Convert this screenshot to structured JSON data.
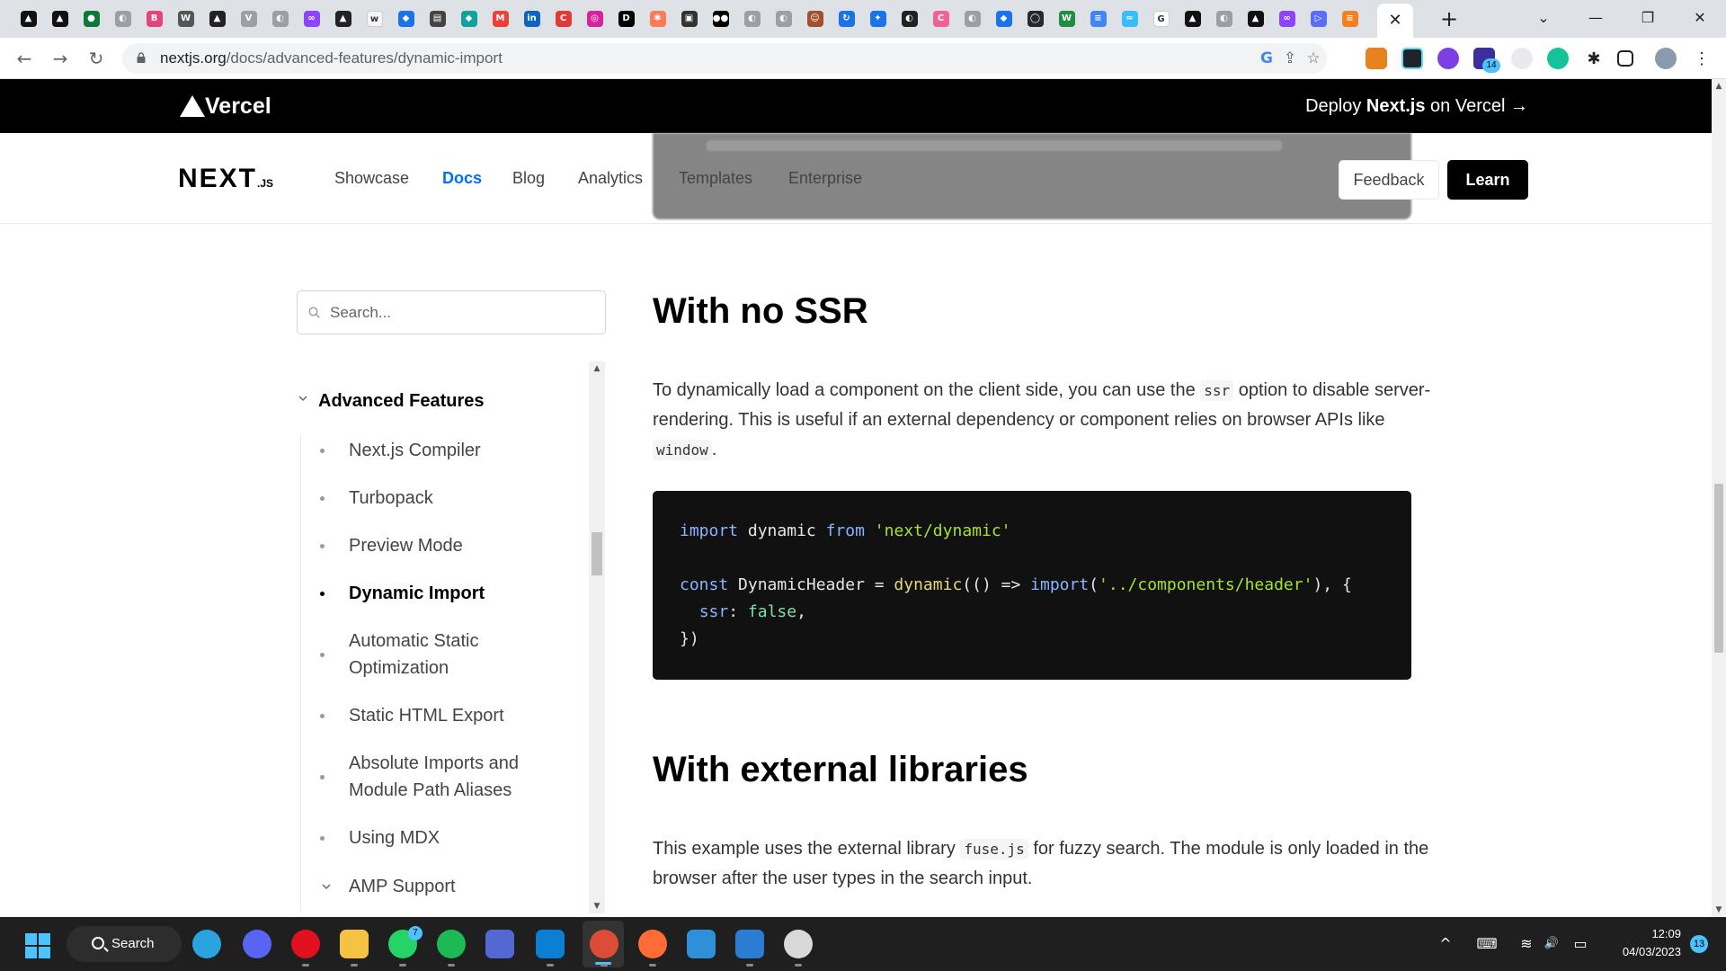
{
  "browser": {
    "tab_favicons": [
      {
        "name": "tab-favicon-1",
        "color": "#111111",
        "glyph": "▲"
      },
      {
        "name": "tab-favicon-2",
        "color": "#111111",
        "glyph": "▲"
      },
      {
        "name": "tab-favicon-3",
        "color": "#0a7a3a",
        "glyph": "●"
      },
      {
        "name": "tab-favicon-4",
        "color": "#9aa0a6",
        "glyph": "◐"
      },
      {
        "name": "tab-favicon-5",
        "color": "#e5447a",
        "glyph": "B"
      },
      {
        "name": "tab-favicon-6",
        "color": "#555555",
        "glyph": "W"
      },
      {
        "name": "tab-favicon-7",
        "color": "#222222",
        "glyph": "▲"
      },
      {
        "name": "tab-favicon-8",
        "color": "#9aa0a6",
        "glyph": "V"
      },
      {
        "name": "tab-favicon-9",
        "color": "#9aa0a6",
        "glyph": "◐"
      },
      {
        "name": "tab-favicon-10",
        "color": "#8e44ff",
        "glyph": "∞"
      },
      {
        "name": "tab-favicon-11",
        "color": "#222222",
        "glyph": "▲"
      },
      {
        "name": "tab-favicon-12",
        "color": "#f5f5f5",
        "glyph": "w"
      },
      {
        "name": "tab-favicon-13",
        "color": "#1a73e8",
        "glyph": "◆"
      },
      {
        "name": "tab-favicon-14",
        "color": "#444444",
        "glyph": "▤"
      },
      {
        "name": "tab-favicon-15",
        "color": "#10a39e",
        "glyph": "◆"
      },
      {
        "name": "tab-favicon-16",
        "color": "#ea4335",
        "glyph": "M"
      },
      {
        "name": "tab-favicon-17",
        "color": "#0a66c2",
        "glyph": "in"
      },
      {
        "name": "tab-favicon-18",
        "color": "#e03a3a",
        "glyph": "C"
      },
      {
        "name": "tab-favicon-19",
        "color": "#d6249f",
        "glyph": "◎"
      },
      {
        "name": "tab-favicon-20",
        "color": "#000000",
        "glyph": "D"
      },
      {
        "name": "tab-favicon-21",
        "color": "#ff7a59",
        "glyph": "✱"
      },
      {
        "name": "tab-favicon-22",
        "color": "#333333",
        "glyph": "▣"
      },
      {
        "name": "tab-favicon-23",
        "color": "#000000",
        "glyph": "●●"
      },
      {
        "name": "tab-favicon-24",
        "color": "#9aa0a6",
        "glyph": "◐"
      },
      {
        "name": "tab-favicon-25",
        "color": "#9aa0a6",
        "glyph": "◐"
      },
      {
        "name": "tab-favicon-26",
        "color": "#a0522d",
        "glyph": "☺"
      },
      {
        "name": "tab-favicon-27",
        "color": "#1a73e8",
        "glyph": "↻"
      },
      {
        "name": "tab-favicon-28",
        "color": "#1a73e8",
        "glyph": "✦"
      },
      {
        "name": "tab-favicon-29",
        "color": "#222222",
        "glyph": "◐"
      },
      {
        "name": "tab-favicon-30",
        "color": "#f06292",
        "glyph": "C"
      },
      {
        "name": "tab-favicon-31",
        "color": "#9aa0a6",
        "glyph": "◐"
      },
      {
        "name": "tab-favicon-32",
        "color": "#1a73e8",
        "glyph": "◆"
      },
      {
        "name": "tab-favicon-33",
        "color": "#24292e",
        "glyph": "◯"
      },
      {
        "name": "tab-favicon-34",
        "color": "#1e8e3e",
        "glyph": "W"
      },
      {
        "name": "tab-favicon-35",
        "color": "#4285f4",
        "glyph": "≡"
      },
      {
        "name": "tab-favicon-36",
        "color": "#38bdf8",
        "glyph": "≈"
      },
      {
        "name": "tab-favicon-37",
        "color": "#ffffff",
        "glyph": "G"
      },
      {
        "name": "tab-favicon-38",
        "color": "#111111",
        "glyph": "▲"
      },
      {
        "name": "tab-favicon-39",
        "color": "#9aa0a6",
        "glyph": "◐"
      },
      {
        "name": "tab-favicon-40",
        "color": "#111111",
        "glyph": "▲"
      },
      {
        "name": "tab-favicon-41",
        "color": "#8e44ff",
        "glyph": "∞"
      },
      {
        "name": "tab-favicon-42",
        "color": "#5b6ef5",
        "glyph": "▷"
      },
      {
        "name": "tab-favicon-43",
        "color": "#f48024",
        "glyph": "≡"
      }
    ],
    "active_tab_close": "✕",
    "new_tab": "+",
    "window_controls": {
      "collapse": "⌄",
      "minimize": "—",
      "restore": "❐",
      "close": "✕"
    },
    "url_domain": "nextjs.org",
    "url_path": "/docs/advanced-features/dynamic-import",
    "nav": {
      "back": "←",
      "forward": "→",
      "reload": "↻"
    },
    "omnibox_actions": {
      "google": "G",
      "share": "⇪",
      "bookmark": "☆"
    },
    "extensions_badge": "14",
    "colors": {
      "tabstrip": "#dee1e6",
      "omnibox": "#f1f3f4"
    }
  },
  "banner": {
    "brand": "Vercel",
    "deploy_prefix": "Deploy ",
    "deploy_brand": "Next.js",
    "deploy_suffix": " on Vercel →"
  },
  "header": {
    "logo_main": "NEXT",
    "logo_suffix": ".JS",
    "nav": [
      {
        "label": "Showcase",
        "active": false
      },
      {
        "label": "Docs",
        "active": true
      },
      {
        "label": "Blog",
        "active": false
      },
      {
        "label": "Analytics",
        "active": false
      },
      {
        "label": "Templates",
        "active": false
      },
      {
        "label": "Enterprise",
        "active": false
      }
    ],
    "feedback_label": "Feedback",
    "learn_label": "Learn",
    "accent_color": "#0070f3"
  },
  "sidebar": {
    "search_placeholder": "Search...",
    "section_label": "Advanced Features",
    "items": [
      {
        "label": "Next.js Compiler"
      },
      {
        "label": "Turbopack"
      },
      {
        "label": "Preview Mode"
      },
      {
        "label": "Dynamic Import",
        "active": true
      },
      {
        "label": "Automatic Static Optimization"
      },
      {
        "label": "Static HTML Export"
      },
      {
        "label": "Absolute Imports and Module Path Aliases"
      },
      {
        "label": "Using MDX"
      },
      {
        "label": "AMP Support",
        "collapsible": true
      }
    ]
  },
  "content": {
    "heading_1": "With no SSR",
    "para_1_a": "To dynamically load a component on the client side, you can use the ",
    "para_1_code_1": "ssr",
    "para_1_b": " option to disable server-rendering. This is useful if an external dependency or component relies on browser APIs like ",
    "para_1_code_2": "window",
    "para_1_c": ".",
    "code": {
      "line1_import": "import",
      "line1_name": " dynamic ",
      "line1_from": "from",
      "line1_src": "'next/dynamic'",
      "line3_const": "const",
      "line3_name": " DynamicHeader = ",
      "line3_fn": "dynamic",
      "line3_mid": "(() => ",
      "line3_import": "import",
      "line3_open": "(",
      "line3_path": "'../components/header'",
      "line3_end": "), {",
      "line4_prop": "ssr",
      "line4_colon": ": ",
      "line4_val": "false",
      "line4_comma": ",",
      "line5": "})"
    },
    "heading_2": "With external libraries",
    "para_2_a": "This example uses the external library ",
    "para_2_code": "fuse.js",
    "para_2_b": " for fuzzy search. The module is only loaded in the browser after the user types in the search input."
  },
  "taskbar": {
    "search_label": "Search",
    "apps": [
      {
        "name": "telegram-icon",
        "color": "#2aa3df"
      },
      {
        "name": "discord-icon",
        "color": "#5865f2"
      },
      {
        "name": "opera-icon",
        "color": "#e0101e"
      },
      {
        "name": "file-explorer-icon",
        "color": "#f6c243"
      },
      {
        "name": "whatsapp-icon",
        "color": "#25d366"
      },
      {
        "name": "spotify-icon",
        "color": "#1db954"
      },
      {
        "name": "globe-app-icon",
        "color": "#5468d4"
      },
      {
        "name": "vscode-icon",
        "color": "#0a7fd4"
      },
      {
        "name": "chrome-icon",
        "color": "#dd4b39"
      },
      {
        "name": "postman-icon",
        "color": "#ff6c37"
      },
      {
        "name": "azure-data-icon",
        "color": "#2f8fd8"
      },
      {
        "name": "word-icon",
        "color": "#2b7cd3"
      },
      {
        "name": "clock-app-icon",
        "color": "#d9d9d9"
      }
    ],
    "whatsapp_badge": "7",
    "tray": {
      "chevron": "^",
      "keyboard": "⌨",
      "wifi": "≋",
      "volume": "🔊",
      "battery": "▭"
    },
    "time": "12:09",
    "date": "04/03/2023",
    "notifications": "13"
  }
}
